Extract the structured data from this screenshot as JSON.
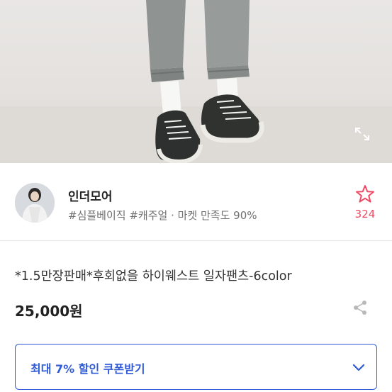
{
  "seller": {
    "name": "인더모어",
    "tags": "#심플베이직 #캐주얼 · 마켓 만족도 90%",
    "favorite_count": "324"
  },
  "product": {
    "title": "*1.5만장판매*후회없을 하이웨스트 일자팬츠-6color",
    "price": "25,000원"
  },
  "coupon": {
    "label": "최대 7% 할인 쿠폰받기"
  },
  "icons": {
    "expand": "expand-icon",
    "favorite": "star-outline-icon",
    "share": "share-icon",
    "coupon_toggle": "chevron-down-icon"
  },
  "colors": {
    "accent_blue": "#2f5bd6",
    "favorite_pink": "#f04763"
  }
}
